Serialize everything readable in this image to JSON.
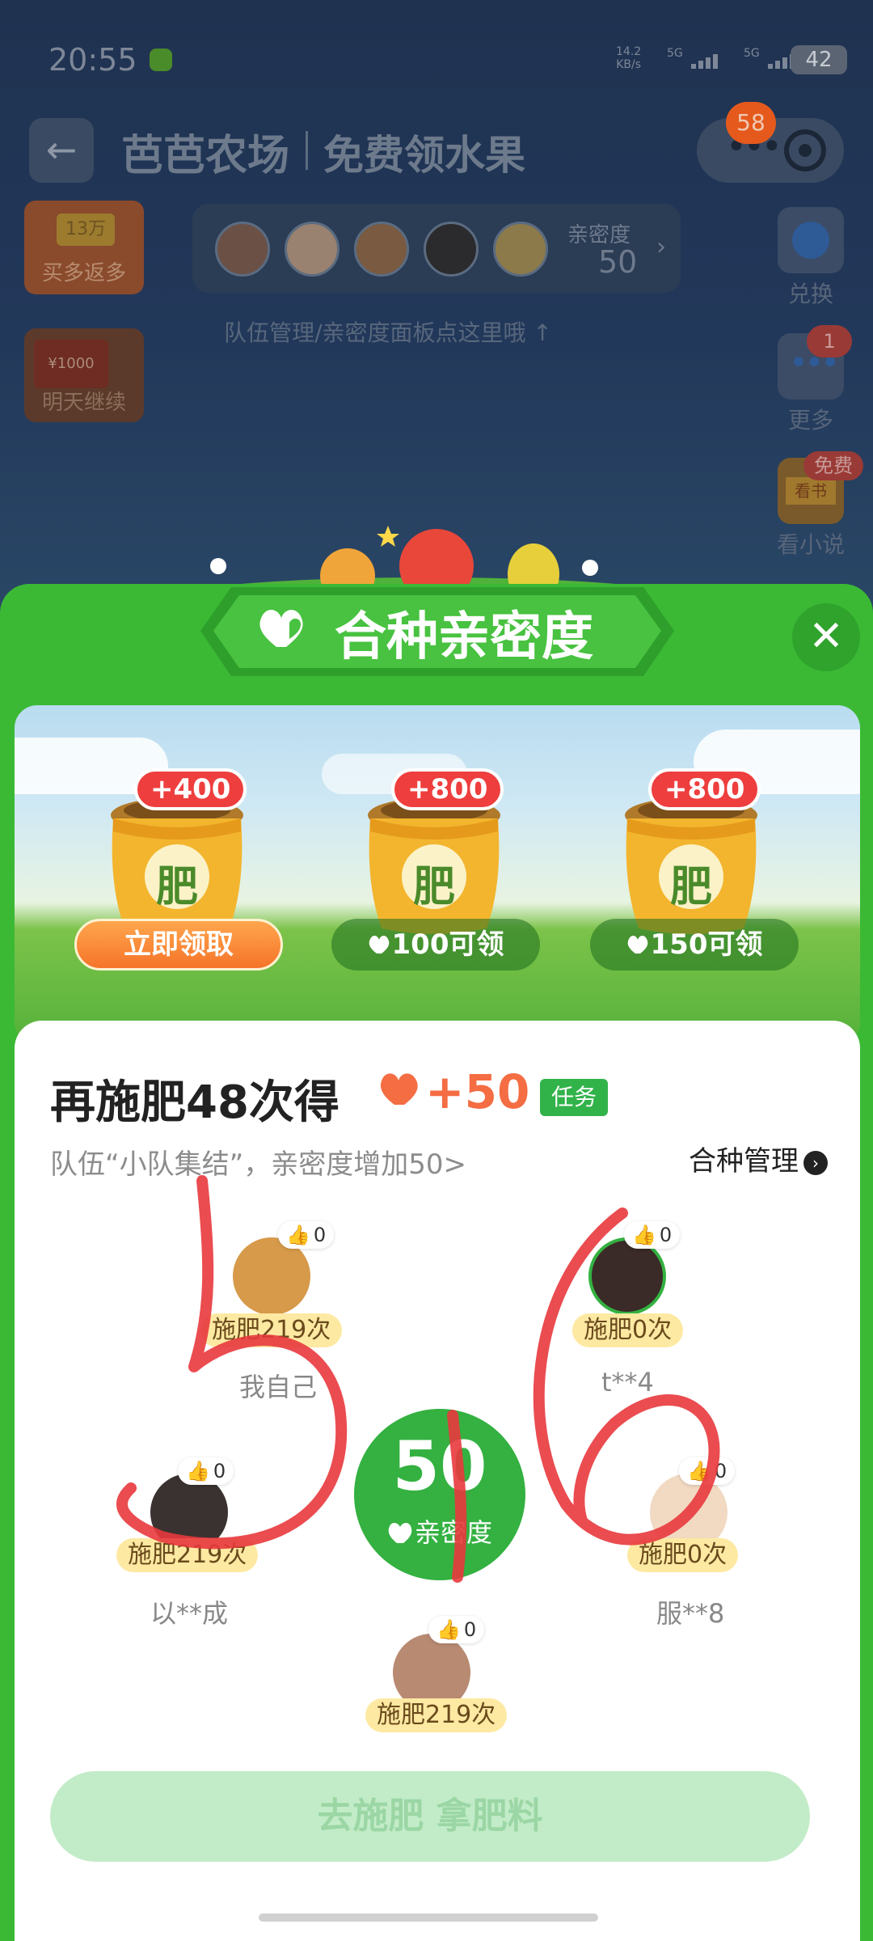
{
  "status_bar": {
    "time": "20:55",
    "net_speed": "14.2",
    "net_unit": "KB/s",
    "signal1": "5G",
    "signal2": "5G",
    "battery": "42"
  },
  "header": {
    "app_name": "芭芭农场",
    "subtitle": "免费领水果",
    "notification_count": "58"
  },
  "left_promos": [
    {
      "tag": "13万",
      "label": "买多返多"
    },
    {
      "tag": "¥1000",
      "label": "明天继续"
    }
  ],
  "team_bar": {
    "intimacy_label": "亲密度",
    "intimacy_value": "50",
    "hint": "队伍管理/亲密度面板点这里哦 ↑"
  },
  "side_menu": [
    {
      "label": "兑换",
      "icon": "exchange-icon"
    },
    {
      "label": "更多",
      "icon": "more-icon",
      "badge": "1"
    },
    {
      "label": "看小说",
      "icon": "book-icon",
      "badge": "免费",
      "book_text": "看书"
    }
  ],
  "modal": {
    "title": "合种亲密度",
    "rewards": [
      {
        "amount": "+400",
        "action": "立即领取",
        "bag_char": "肥"
      },
      {
        "amount": "+800",
        "action": "100可领",
        "bag_char": "肥"
      },
      {
        "amount": "+800",
        "action": "150可领",
        "bag_char": "肥"
      }
    ],
    "task": {
      "title": "再施肥48次得",
      "bonus": "+50",
      "tag": "任务",
      "subtitle": "队伍“小队集结”，亲密度增加50>",
      "manage_link": "合种管理"
    },
    "center": {
      "value": "50",
      "label": "亲密度"
    },
    "members": [
      {
        "likes": "0",
        "count": "施肥219次",
        "name": "我自己"
      },
      {
        "likes": "0",
        "count": "施肥0次",
        "name": "t**4"
      },
      {
        "likes": "0",
        "count": "施肥219次",
        "name": "以**成"
      },
      {
        "likes": "0",
        "count": "施肥0次",
        "name": "服**8"
      },
      {
        "likes": "0",
        "count": "施肥219次",
        "name": ""
      }
    ],
    "primary_button": "去施肥 拿肥料"
  },
  "handwriting": "516",
  "colors": {
    "sheet_green": "#3bb935",
    "claim_orange": "#f5742a",
    "reward_red": "#ee3e3e",
    "ink_red": "#e8383d"
  }
}
